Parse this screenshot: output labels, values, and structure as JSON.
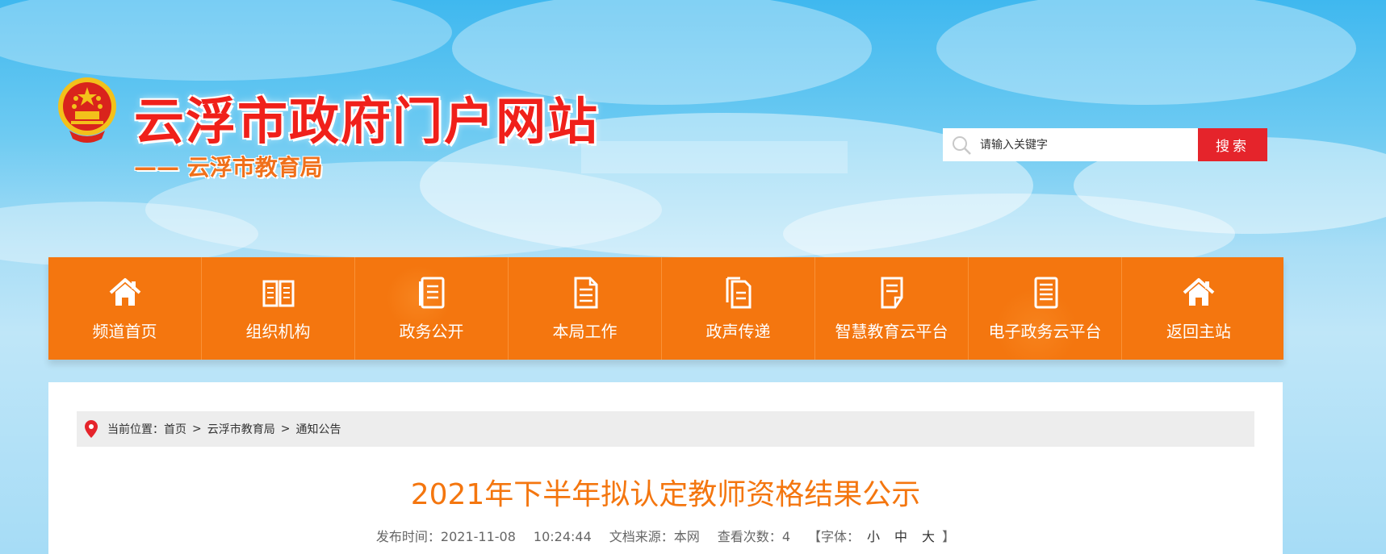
{
  "header": {
    "site_title": "云浮市政府门户网站",
    "sub_title": "—— 云浮市教育局"
  },
  "search": {
    "placeholder": "请输入关键字",
    "button_label": "搜索"
  },
  "nav": {
    "items": [
      {
        "label": "频道首页",
        "icon": "home-icon"
      },
      {
        "label": "组织机构",
        "icon": "book-icon"
      },
      {
        "label": "政务公开",
        "icon": "document-icon"
      },
      {
        "label": "本局工作",
        "icon": "file-icon"
      },
      {
        "label": "政声传递",
        "icon": "files-icon"
      },
      {
        "label": "智慧教育云平台",
        "icon": "notepad-icon"
      },
      {
        "label": "电子政务云平台",
        "icon": "list-document-icon"
      },
      {
        "label": "返回主站",
        "icon": "home-icon"
      }
    ]
  },
  "breadcrumb": {
    "prefix": "当前位置：",
    "items": [
      "首页",
      "云浮市教育局",
      "通知公告"
    ],
    "separator": ">"
  },
  "article": {
    "title": "2021年下半年拟认定教师资格结果公示",
    "publish_label": "发布时间：",
    "publish_date": "2021-11-08",
    "publish_time": "10:24:44",
    "source_label": "文档来源：",
    "source": "本网",
    "views_label": "查看次数：",
    "views": "4",
    "font_label": "【字体：",
    "font_small": "小",
    "font_medium": "中",
    "font_large": "大",
    "font_close": "】"
  },
  "colors": {
    "nav_orange": "#f4760f",
    "search_red": "#e5242b",
    "title_red": "#f0201a"
  }
}
